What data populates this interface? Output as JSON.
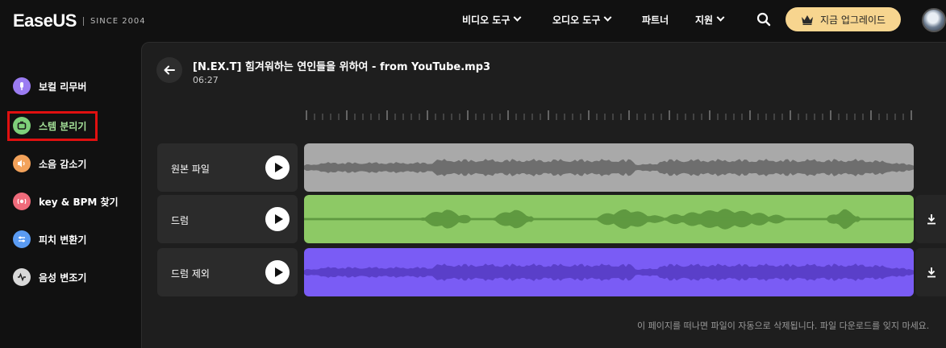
{
  "header": {
    "logo_text": "EaseUS",
    "logo_since": "SINCE 2004",
    "nav": [
      {
        "label": "비디오 도구",
        "has_dropdown": true
      },
      {
        "label": "오디오 도구",
        "has_dropdown": true
      },
      {
        "label": "파트너",
        "has_dropdown": false
      },
      {
        "label": "지원",
        "has_dropdown": true
      }
    ],
    "search_icon": "search-icon",
    "upgrade_label": "지금 업그레이드",
    "upgrade_icon": "crown-icon"
  },
  "sidebar": {
    "items": [
      {
        "label": "보컬 리무버",
        "icon": "mic-icon",
        "color": "#9b7cf2"
      },
      {
        "label": "스템 분리기",
        "icon": "stem-icon",
        "color": "#7ed07a",
        "selected": true
      },
      {
        "label": "소음 감소기",
        "icon": "noise-icon",
        "color": "#f3a25a"
      },
      {
        "label": "key & BPM 찾기",
        "icon": "key-bpm-icon",
        "color": "#ef6b7b"
      },
      {
        "label": "피치 변환기",
        "icon": "pitch-icon",
        "color": "#5a9bf3"
      },
      {
        "label": "음성 변조기",
        "icon": "voice-icon",
        "color": "#d9d9d9"
      }
    ]
  },
  "main": {
    "file_title": "[N.EX.T] 힘겨워하는 연인들을 위하여 - from YouTube.mp3",
    "duration": "06:27",
    "tracks": [
      {
        "name": "원본 파일",
        "color": "#a9a9a9",
        "wave_color": "#6e6e6e",
        "downloadable": false
      },
      {
        "name": "드럼",
        "color": "#8dc965",
        "wave_color": "#5f9940",
        "downloadable": true
      },
      {
        "name": "드럼 제외",
        "color": "#7a5cf5",
        "wave_color": "#5a3fc9",
        "downloadable": true
      }
    ],
    "notice": "이 페이지를 떠나면 파일이 자동으로 삭제됩니다. 파일 다운로드를 잊지 마세요."
  }
}
